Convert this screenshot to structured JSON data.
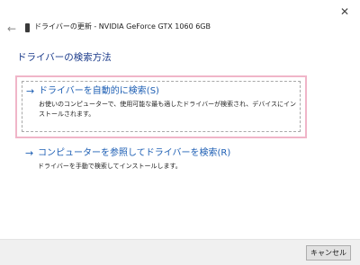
{
  "window": {
    "title": "ドライバーの更新 - NVIDIA GeForce GTX 1060 6GB",
    "close_glyph": "✕",
    "back_glyph": "←"
  },
  "main": {
    "heading": "ドライバーの検索方法",
    "options": [
      {
        "arrow": "→",
        "title": "ドライバーを自動的に検索(S)",
        "description": "お使いのコンピューターで、使用可能な最も適したドライバーが検索され、デバイスにインストールされます。"
      },
      {
        "arrow": "→",
        "title": "コンピューターを参照してドライバーを検索(R)",
        "description": "ドライバーを手動で検索してインストールします。"
      }
    ]
  },
  "footer": {
    "cancel_label": "キャンセル"
  },
  "colors": {
    "link_blue": "#1e5fb4",
    "heading_blue": "#1a3a8a",
    "highlight_pink": "#f0b5c8"
  },
  "icons": {
    "close": "close-icon",
    "back": "back-arrow-icon",
    "device": "device-icon",
    "option_arrow": "arrow-right-icon"
  }
}
